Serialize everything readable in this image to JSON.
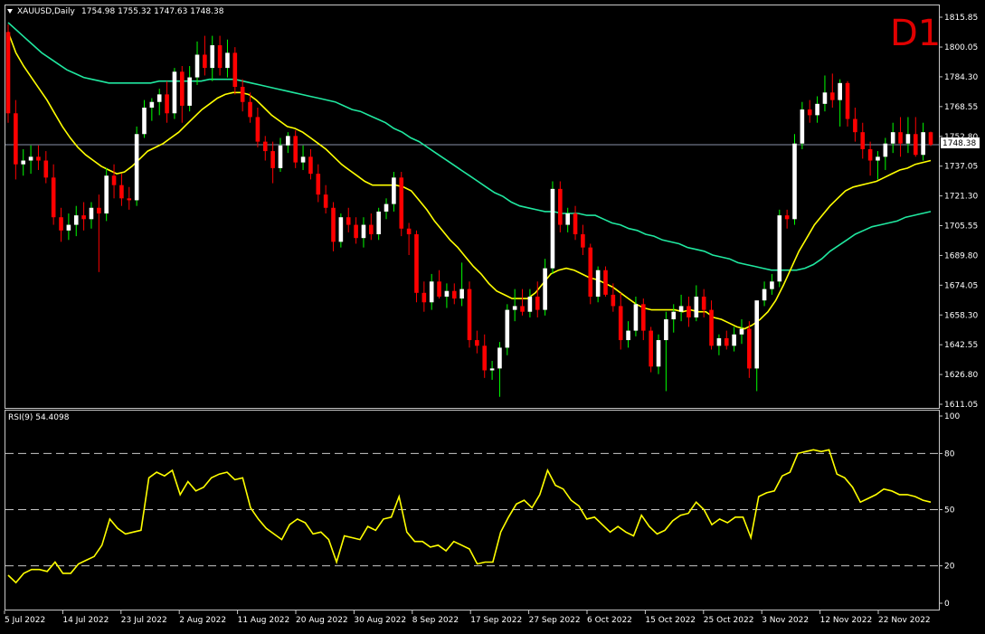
{
  "main_panel": {
    "title": "XAUUSD,Daily",
    "ohlc": "1754.98 1755.32 1747.63 1748.38",
    "timeframe_label": "D1",
    "current_price": "1748.38"
  },
  "rsi_panel": {
    "title": "RSI(9) 54.4098"
  },
  "colors": {
    "background": "#000000",
    "bull_candle": "#ffffff",
    "bear_candle": "#ff0000",
    "wick_bull": "#00ff00",
    "wick_bear": "#ff0000",
    "ma_fast": "#ffff00",
    "ma_slow": "#20e8a0",
    "rsi_line": "#ffff00",
    "grid_dash": "#c8c8c8",
    "price_line": "#8890a8",
    "timeframe": "#e00000"
  },
  "chart_data": [
    {
      "type": "candlestick",
      "symbol": "XAUUSD",
      "period": "Daily",
      "ylim": [
        1611.05,
        1815.85
      ],
      "y_ticks": [
        "1815.85",
        "1800.05",
        "1784.30",
        "1768.55",
        "1752.80",
        "1737.05",
        "1721.30",
        "1705.55",
        "1689.80",
        "1674.05",
        "1658.30",
        "1642.55",
        "1626.80",
        "1611.05"
      ],
      "x_ticks": [
        "5 Jul 2022",
        "14 Jul 2022",
        "23 Jul 2022",
        "2 Aug 2022",
        "11 Aug 2022",
        "20 Aug 2022",
        "30 Aug 2022",
        "8 Sep 2022",
        "17 Sep 2022",
        "27 Sep 2022",
        "6 Oct 2022",
        "15 Oct 2022",
        "25 Oct 2022",
        "3 Nov 2022",
        "12 Nov 2022",
        "22 Nov 2022"
      ],
      "last_price": 1748.38,
      "candles": [
        {
          "o": 1808,
          "h": 1812,
          "l": 1760,
          "c": 1765
        },
        {
          "o": 1765,
          "h": 1772,
          "l": 1730,
          "c": 1738
        },
        {
          "o": 1738,
          "h": 1746,
          "l": 1732,
          "c": 1740
        },
        {
          "o": 1740,
          "h": 1748,
          "l": 1733,
          "c": 1742
        },
        {
          "o": 1742,
          "h": 1748,
          "l": 1735,
          "c": 1740
        },
        {
          "o": 1740,
          "h": 1745,
          "l": 1728,
          "c": 1731
        },
        {
          "o": 1731,
          "h": 1738,
          "l": 1706,
          "c": 1710
        },
        {
          "o": 1710,
          "h": 1715,
          "l": 1697,
          "c": 1703
        },
        {
          "o": 1703,
          "h": 1712,
          "l": 1698,
          "c": 1706
        },
        {
          "o": 1706,
          "h": 1716,
          "l": 1700,
          "c": 1711
        },
        {
          "o": 1711,
          "h": 1718,
          "l": 1703,
          "c": 1709
        },
        {
          "o": 1709,
          "h": 1718,
          "l": 1704,
          "c": 1715
        },
        {
          "o": 1715,
          "h": 1722,
          "l": 1681,
          "c": 1712
        },
        {
          "o": 1712,
          "h": 1736,
          "l": 1708,
          "c": 1732
        },
        {
          "o": 1732,
          "h": 1738,
          "l": 1720,
          "c": 1727
        },
        {
          "o": 1727,
          "h": 1733,
          "l": 1716,
          "c": 1720
        },
        {
          "o": 1720,
          "h": 1726,
          "l": 1714,
          "c": 1719
        },
        {
          "o": 1719,
          "h": 1758,
          "l": 1716,
          "c": 1754
        },
        {
          "o": 1754,
          "h": 1772,
          "l": 1752,
          "c": 1768
        },
        {
          "o": 1768,
          "h": 1773,
          "l": 1761,
          "c": 1771
        },
        {
          "o": 1771,
          "h": 1778,
          "l": 1764,
          "c": 1775
        },
        {
          "o": 1775,
          "h": 1782,
          "l": 1760,
          "c": 1765
        },
        {
          "o": 1765,
          "h": 1789,
          "l": 1762,
          "c": 1787
        },
        {
          "o": 1787,
          "h": 1790,
          "l": 1760,
          "c": 1769
        },
        {
          "o": 1769,
          "h": 1790,
          "l": 1766,
          "c": 1784
        },
        {
          "o": 1784,
          "h": 1803,
          "l": 1780,
          "c": 1796
        },
        {
          "o": 1796,
          "h": 1806,
          "l": 1785,
          "c": 1789
        },
        {
          "o": 1789,
          "h": 1806,
          "l": 1782,
          "c": 1801
        },
        {
          "o": 1801,
          "h": 1806,
          "l": 1785,
          "c": 1789
        },
        {
          "o": 1789,
          "h": 1804,
          "l": 1784,
          "c": 1797
        },
        {
          "o": 1797,
          "h": 1800,
          "l": 1775,
          "c": 1779
        },
        {
          "o": 1779,
          "h": 1783,
          "l": 1766,
          "c": 1771
        },
        {
          "o": 1771,
          "h": 1776,
          "l": 1760,
          "c": 1763
        },
        {
          "o": 1763,
          "h": 1768,
          "l": 1747,
          "c": 1750
        },
        {
          "o": 1750,
          "h": 1753,
          "l": 1740,
          "c": 1745
        },
        {
          "o": 1745,
          "h": 1750,
          "l": 1728,
          "c": 1736
        },
        {
          "o": 1736,
          "h": 1752,
          "l": 1734,
          "c": 1748
        },
        {
          "o": 1748,
          "h": 1755,
          "l": 1744,
          "c": 1753
        },
        {
          "o": 1753,
          "h": 1756,
          "l": 1736,
          "c": 1739
        },
        {
          "o": 1739,
          "h": 1748,
          "l": 1735,
          "c": 1742
        },
        {
          "o": 1742,
          "h": 1746,
          "l": 1730,
          "c": 1733
        },
        {
          "o": 1733,
          "h": 1738,
          "l": 1718,
          "c": 1722
        },
        {
          "o": 1722,
          "h": 1727,
          "l": 1712,
          "c": 1715
        },
        {
          "o": 1715,
          "h": 1718,
          "l": 1692,
          "c": 1697
        },
        {
          "o": 1697,
          "h": 1712,
          "l": 1694,
          "c": 1710
        },
        {
          "o": 1710,
          "h": 1715,
          "l": 1702,
          "c": 1706
        },
        {
          "o": 1706,
          "h": 1710,
          "l": 1696,
          "c": 1699
        },
        {
          "o": 1699,
          "h": 1710,
          "l": 1694,
          "c": 1706
        },
        {
          "o": 1706,
          "h": 1712,
          "l": 1698,
          "c": 1701
        },
        {
          "o": 1701,
          "h": 1715,
          "l": 1698,
          "c": 1713
        },
        {
          "o": 1713,
          "h": 1720,
          "l": 1709,
          "c": 1717
        },
        {
          "o": 1717,
          "h": 1734,
          "l": 1713,
          "c": 1731
        },
        {
          "o": 1731,
          "h": 1734,
          "l": 1700,
          "c": 1704
        },
        {
          "o": 1704,
          "h": 1707,
          "l": 1690,
          "c": 1701
        },
        {
          "o": 1701,
          "h": 1703,
          "l": 1665,
          "c": 1670
        },
        {
          "o": 1670,
          "h": 1676,
          "l": 1660,
          "c": 1665
        },
        {
          "o": 1665,
          "h": 1680,
          "l": 1661,
          "c": 1676
        },
        {
          "o": 1676,
          "h": 1682,
          "l": 1667,
          "c": 1668
        },
        {
          "o": 1668,
          "h": 1675,
          "l": 1662,
          "c": 1671
        },
        {
          "o": 1671,
          "h": 1675,
          "l": 1664,
          "c": 1667
        },
        {
          "o": 1667,
          "h": 1686,
          "l": 1663,
          "c": 1672
        },
        {
          "o": 1672,
          "h": 1676,
          "l": 1641,
          "c": 1645
        },
        {
          "o": 1645,
          "h": 1650,
          "l": 1638,
          "c": 1642
        },
        {
          "o": 1642,
          "h": 1648,
          "l": 1625,
          "c": 1629
        },
        {
          "o": 1629,
          "h": 1634,
          "l": 1624,
          "c": 1630
        },
        {
          "o": 1630,
          "h": 1644,
          "l": 1615,
          "c": 1641
        },
        {
          "o": 1641,
          "h": 1664,
          "l": 1637,
          "c": 1661
        },
        {
          "o": 1661,
          "h": 1672,
          "l": 1655,
          "c": 1663
        },
        {
          "o": 1663,
          "h": 1672,
          "l": 1658,
          "c": 1660
        },
        {
          "o": 1660,
          "h": 1672,
          "l": 1657,
          "c": 1668
        },
        {
          "o": 1668,
          "h": 1676,
          "l": 1657,
          "c": 1661
        },
        {
          "o": 1661,
          "h": 1688,
          "l": 1658,
          "c": 1683
        },
        {
          "o": 1683,
          "h": 1729,
          "l": 1680,
          "c": 1725
        },
        {
          "o": 1725,
          "h": 1729,
          "l": 1702,
          "c": 1706
        },
        {
          "o": 1706,
          "h": 1715,
          "l": 1702,
          "c": 1712
        },
        {
          "o": 1712,
          "h": 1716,
          "l": 1698,
          "c": 1701
        },
        {
          "o": 1701,
          "h": 1706,
          "l": 1690,
          "c": 1694
        },
        {
          "o": 1694,
          "h": 1696,
          "l": 1664,
          "c": 1668
        },
        {
          "o": 1668,
          "h": 1684,
          "l": 1665,
          "c": 1682
        },
        {
          "o": 1682,
          "h": 1684,
          "l": 1668,
          "c": 1669
        },
        {
          "o": 1669,
          "h": 1675,
          "l": 1660,
          "c": 1663
        },
        {
          "o": 1663,
          "h": 1670,
          "l": 1640,
          "c": 1645
        },
        {
          "o": 1645,
          "h": 1655,
          "l": 1641,
          "c": 1650
        },
        {
          "o": 1650,
          "h": 1668,
          "l": 1647,
          "c": 1664
        },
        {
          "o": 1664,
          "h": 1667,
          "l": 1645,
          "c": 1650
        },
        {
          "o": 1650,
          "h": 1652,
          "l": 1628,
          "c": 1631
        },
        {
          "o": 1631,
          "h": 1648,
          "l": 1627,
          "c": 1645
        },
        {
          "o": 1645,
          "h": 1660,
          "l": 1618,
          "c": 1656
        },
        {
          "o": 1656,
          "h": 1664,
          "l": 1649,
          "c": 1660
        },
        {
          "o": 1660,
          "h": 1669,
          "l": 1655,
          "c": 1663
        },
        {
          "o": 1663,
          "h": 1668,
          "l": 1652,
          "c": 1657
        },
        {
          "o": 1657,
          "h": 1674,
          "l": 1655,
          "c": 1668
        },
        {
          "o": 1668,
          "h": 1672,
          "l": 1657,
          "c": 1661
        },
        {
          "o": 1661,
          "h": 1666,
          "l": 1640,
          "c": 1642
        },
        {
          "o": 1642,
          "h": 1648,
          "l": 1637,
          "c": 1646
        },
        {
          "o": 1646,
          "h": 1650,
          "l": 1640,
          "c": 1642
        },
        {
          "o": 1642,
          "h": 1652,
          "l": 1639,
          "c": 1648
        },
        {
          "o": 1648,
          "h": 1656,
          "l": 1643,
          "c": 1651
        },
        {
          "o": 1651,
          "h": 1655,
          "l": 1625,
          "c": 1630
        },
        {
          "o": 1630,
          "h": 1662,
          "l": 1618,
          "c": 1666
        },
        {
          "o": 1666,
          "h": 1676,
          "l": 1663,
          "c": 1672
        },
        {
          "o": 1672,
          "h": 1680,
          "l": 1669,
          "c": 1676
        },
        {
          "o": 1676,
          "h": 1714,
          "l": 1673,
          "c": 1711
        },
        {
          "o": 1711,
          "h": 1714,
          "l": 1704,
          "c": 1709
        },
        {
          "o": 1709,
          "h": 1754,
          "l": 1706,
          "c": 1749
        },
        {
          "o": 1749,
          "h": 1771,
          "l": 1746,
          "c": 1767
        },
        {
          "o": 1767,
          "h": 1772,
          "l": 1760,
          "c": 1764
        },
        {
          "o": 1764,
          "h": 1774,
          "l": 1760,
          "c": 1770
        },
        {
          "o": 1770,
          "h": 1785,
          "l": 1766,
          "c": 1776
        },
        {
          "o": 1776,
          "h": 1786,
          "l": 1768,
          "c": 1772
        },
        {
          "o": 1772,
          "h": 1783,
          "l": 1758,
          "c": 1781
        },
        {
          "o": 1781,
          "h": 1782,
          "l": 1758,
          "c": 1762
        },
        {
          "o": 1762,
          "h": 1768,
          "l": 1750,
          "c": 1755
        },
        {
          "o": 1755,
          "h": 1760,
          "l": 1741,
          "c": 1746
        },
        {
          "o": 1746,
          "h": 1750,
          "l": 1732,
          "c": 1740
        },
        {
          "o": 1740,
          "h": 1745,
          "l": 1730,
          "c": 1742
        },
        {
          "o": 1742,
          "h": 1752,
          "l": 1735,
          "c": 1749
        },
        {
          "o": 1749,
          "h": 1760,
          "l": 1744,
          "c": 1755
        },
        {
          "o": 1755,
          "h": 1763,
          "l": 1742,
          "c": 1749
        },
        {
          "o": 1749,
          "h": 1763,
          "l": 1744,
          "c": 1754
        },
        {
          "o": 1754,
          "h": 1763,
          "l": 1742,
          "c": 1743
        },
        {
          "o": 1743,
          "h": 1760,
          "l": 1740,
          "c": 1755
        },
        {
          "o": 1754.98,
          "h": 1755.32,
          "l": 1747.63,
          "c": 1748.38
        }
      ],
      "ma_fast": [
        1808,
        1797,
        1790,
        1784,
        1778,
        1772,
        1765,
        1758,
        1752,
        1747,
        1743,
        1740,
        1737,
        1735,
        1733,
        1734,
        1737,
        1741,
        1745,
        1747,
        1749,
        1752,
        1755,
        1759,
        1763,
        1767,
        1770,
        1773,
        1775,
        1776,
        1776,
        1775,
        1772,
        1768,
        1764,
        1761,
        1758,
        1757,
        1755,
        1752,
        1749,
        1746,
        1742,
        1738,
        1735,
        1732,
        1729,
        1727,
        1727,
        1727,
        1727,
        1726,
        1724,
        1719,
        1714,
        1708,
        1703,
        1698,
        1694,
        1689,
        1684,
        1680,
        1675,
        1671,
        1669,
        1667,
        1667,
        1667,
        1670,
        1675,
        1680,
        1682,
        1683,
        1682,
        1680,
        1678,
        1677,
        1675,
        1673,
        1670,
        1667,
        1664,
        1662,
        1661,
        1661,
        1661,
        1661,
        1660,
        1661,
        1660,
        1660,
        1657,
        1656,
        1654,
        1652,
        1651,
        1653,
        1656,
        1660,
        1666,
        1674,
        1683,
        1692,
        1699,
        1706,
        1711,
        1716,
        1720,
        1724,
        1726,
        1727,
        1728,
        1729,
        1731,
        1733,
        1735,
        1736,
        1738,
        1739,
        1740
      ],
      "ma_slow": [
        1813,
        1809,
        1805,
        1801,
        1797,
        1794,
        1791,
        1788,
        1786,
        1784,
        1783,
        1782,
        1781,
        1781,
        1781,
        1781,
        1781,
        1781,
        1782,
        1782,
        1782,
        1782,
        1782,
        1782,
        1783,
        1783,
        1783,
        1783,
        1782,
        1781,
        1780,
        1779,
        1778,
        1777,
        1776,
        1775,
        1774,
        1773,
        1772,
        1771,
        1769,
        1767,
        1766,
        1764,
        1762,
        1760,
        1757,
        1755,
        1752,
        1750,
        1747,
        1744,
        1741,
        1738,
        1735,
        1732,
        1729,
        1726,
        1723,
        1721,
        1718,
        1716,
        1715,
        1714,
        1713,
        1713,
        1712,
        1712,
        1712,
        1711,
        1711,
        1709,
        1707,
        1706,
        1704,
        1703,
        1701,
        1700,
        1698,
        1697,
        1696,
        1694,
        1693,
        1692,
        1690,
        1689,
        1688,
        1686,
        1685,
        1684,
        1683,
        1682,
        1682,
        1682,
        1682,
        1683,
        1685,
        1688,
        1692,
        1695,
        1698,
        1701,
        1703,
        1705,
        1706,
        1707,
        1708,
        1710,
        1711,
        1712,
        1713
      ],
      "series": [
        {
          "name": "",
          "color": "#ffff00",
          "kind": "moving-average"
        },
        {
          "name": "",
          "color": "#20e8a0",
          "kind": "moving-average"
        }
      ]
    },
    {
      "type": "line",
      "indicator": "RSI(9)",
      "ylim": [
        0,
        100
      ],
      "y_ticks": [
        "100",
        "80",
        "50",
        "20",
        "0"
      ],
      "levels": [
        80,
        50,
        20
      ],
      "values": [
        15,
        11,
        16,
        18,
        18,
        17,
        22,
        16,
        16,
        21,
        23,
        25,
        31,
        45,
        40,
        37,
        38,
        39,
        67,
        70,
        68,
        71,
        58,
        65,
        60,
        62,
        67,
        69,
        70,
        66,
        67,
        51,
        45,
        40,
        37,
        34,
        42,
        45,
        43,
        37,
        38,
        34,
        22,
        36,
        35,
        34,
        41,
        39,
        45,
        46,
        57,
        38,
        33,
        33,
        30,
        31,
        28,
        33,
        31,
        29,
        21,
        22,
        22,
        38,
        46,
        53,
        55,
        51,
        58,
        71,
        63,
        61,
        55,
        52,
        45,
        46,
        42,
        38,
        41,
        38,
        36,
        47,
        41,
        37,
        39,
        44,
        47,
        48,
        54,
        50,
        42,
        45,
        43,
        46,
        46,
        35,
        57,
        59,
        60,
        68,
        70,
        80,
        81,
        82,
        81,
        82,
        69,
        67,
        62,
        54,
        56,
        58,
        61,
        60,
        58,
        58,
        57,
        55,
        54
      ],
      "last_value": 54.4098
    }
  ]
}
